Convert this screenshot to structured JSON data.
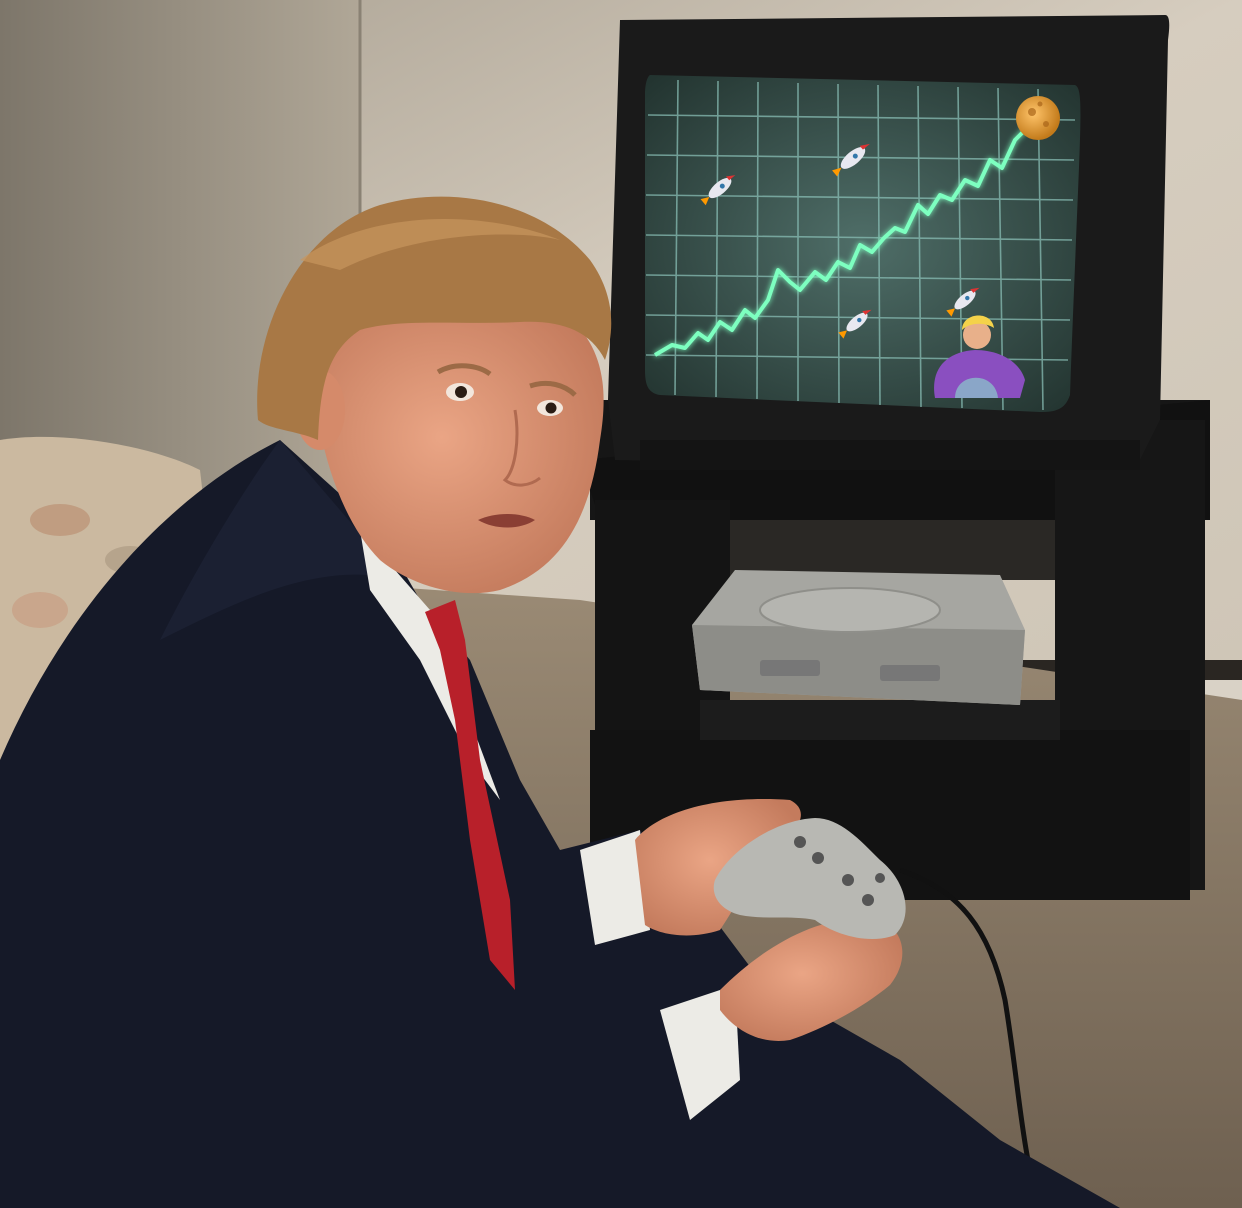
{
  "photo": {
    "palette": {
      "wall": "#d8d0c2",
      "wall_shadow": "#8f877a",
      "carpet": "#8a7a66",
      "suit": "#161a28",
      "skin": "#d98f70",
      "hair": "#a87845",
      "tie": "#b8202a",
      "shirt": "#ecebe6",
      "tv_body": "#1a1a1a",
      "screen_bg": "#3c5a54",
      "grid_line": "#7fb8b0",
      "chart_line": "#7dffc0",
      "console": "#a9a9a4",
      "controller": "#b8b8b3"
    },
    "screen_icons": [
      "rocket-icon",
      "rocket-icon",
      "rocket-icon",
      "rocket-icon",
      "moon-icon",
      "cartoon-character-sprite"
    ]
  }
}
